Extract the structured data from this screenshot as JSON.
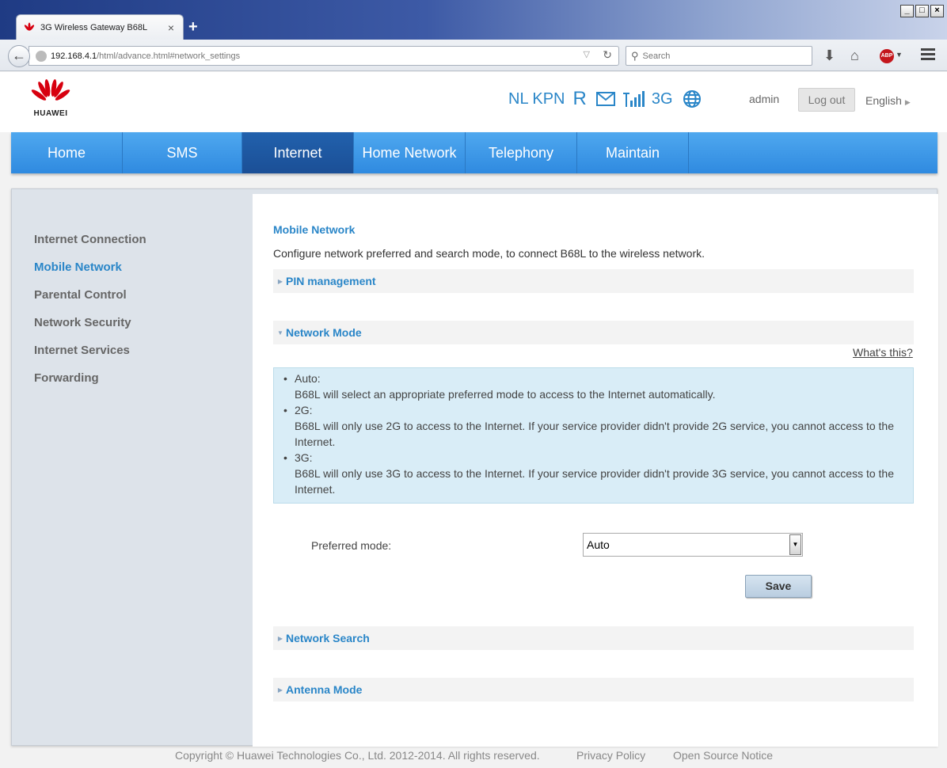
{
  "browser": {
    "tab_title": "3G Wireless Gateway B68L",
    "tab_close": "×",
    "new_tab": "+",
    "url_host": "192.168.4.1",
    "url_path": "/html/advance.html#network_settings",
    "search_placeholder": "Search",
    "window_buttons": [
      "_",
      "□",
      "×"
    ],
    "adblock_label": "ABP"
  },
  "header": {
    "logo_text": "HUAWEI",
    "operator": "NL KPN",
    "roaming_indicator": "R",
    "network_type": "3G",
    "user": "admin",
    "logout_label": "Log out",
    "language": "English"
  },
  "nav": {
    "items": [
      {
        "label": "Home",
        "active": false
      },
      {
        "label": "SMS",
        "active": false
      },
      {
        "label": "Internet",
        "active": true
      },
      {
        "label": "Home Network",
        "active": false
      },
      {
        "label": "Telephony",
        "active": false
      },
      {
        "label": "Maintain",
        "active": false
      }
    ]
  },
  "sidebar": {
    "items": [
      {
        "label": "Internet Connection",
        "active": false
      },
      {
        "label": "Mobile Network",
        "active": true
      },
      {
        "label": "Parental Control",
        "active": false
      },
      {
        "label": "Network Security",
        "active": false
      },
      {
        "label": "Internet Services",
        "active": false
      },
      {
        "label": "Forwarding",
        "active": false
      }
    ]
  },
  "main": {
    "heading": "Mobile Network",
    "description": "Configure network preferred and search mode, to connect B68L to the wireless network.",
    "sections": {
      "pin": "PIN management",
      "network_mode": "Network Mode",
      "network_search": "Network Search",
      "antenna_mode": "Antenna Mode"
    },
    "whats_this": "What's this?",
    "info": [
      {
        "label": "Auto:",
        "text": "B68L will select an appropriate preferred mode to access to the Internet automatically."
      },
      {
        "label": "2G:",
        "text": "B68L will only use 2G to access to the Internet. If your service provider didn't provide 2G service, you cannot access to the Internet."
      },
      {
        "label": "3G:",
        "text": "B68L will only use 3G to access to the Internet. If your service provider didn't provide 3G service, you cannot access to the Internet."
      }
    ],
    "preferred_mode_label": "Preferred mode:",
    "preferred_mode_value": "Auto",
    "save_label": "Save"
  },
  "footer": {
    "copyright": "Copyright © Huawei Technologies Co., Ltd. 2012-2014. All rights reserved.",
    "privacy": "Privacy Policy",
    "open_source": "Open Source Notice"
  },
  "colors": {
    "accent": "#2a86c8",
    "nav_blue": "#3a95e6",
    "nav_active": "#1e5aa4",
    "info_bg": "#d9edf7",
    "brand_red": "#d7000f"
  }
}
